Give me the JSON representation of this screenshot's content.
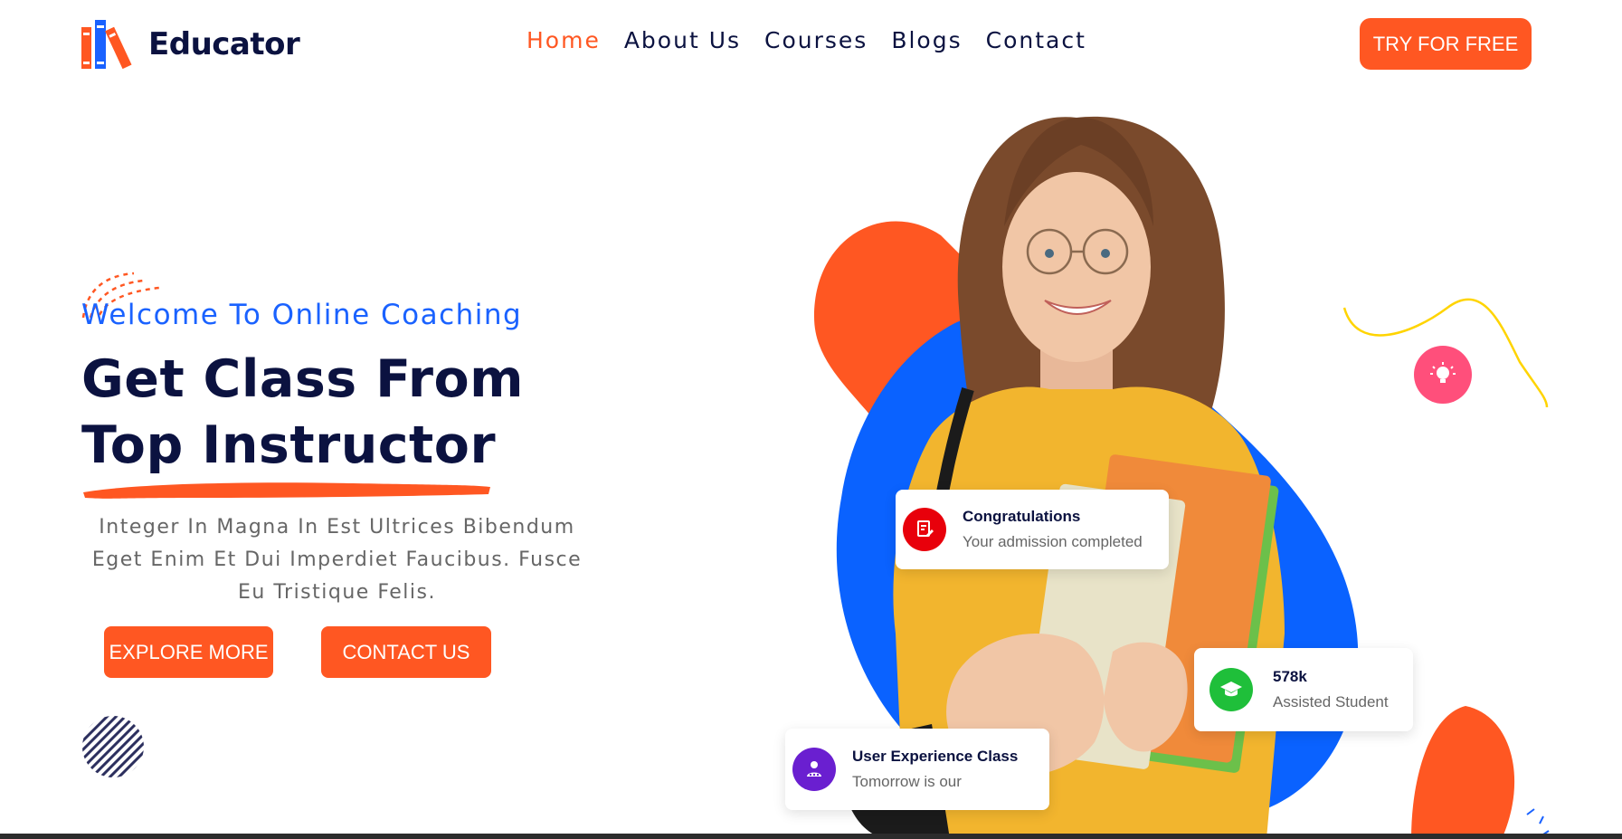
{
  "brand": {
    "name": "Educator",
    "colors": {
      "accent": "#ff5722",
      "primary_blue": "#1a62ff",
      "navy": "#0b1240"
    }
  },
  "nav": {
    "items": [
      {
        "label": "Home",
        "active": true
      },
      {
        "label": "About Us",
        "active": false
      },
      {
        "label": "Courses",
        "active": false
      },
      {
        "label": "Blogs",
        "active": false
      },
      {
        "label": "Contact",
        "active": false
      }
    ],
    "cta": "TRY FOR FREE"
  },
  "hero": {
    "eyebrow": "Welcome To Online Coaching",
    "title_line1": "Get Class From",
    "title_line2": "Top Instructor",
    "description": "Integer In Magna In Est Ultrices Bibendum Eget Enim Et Dui Imperdiet Faucibus. Fusce Eu Tristique Felis.",
    "primary_button": "EXPLORE MORE",
    "secondary_button": "CONTACT US"
  },
  "cards": {
    "congrats": {
      "title": "Congratulations",
      "subtitle": "Your admission completed",
      "icon": "document-edit-icon"
    },
    "students": {
      "title": "578k",
      "subtitle": "Assisted Student",
      "icon": "graduation-cap-icon"
    },
    "ux_class": {
      "title": "User Experience Class",
      "subtitle": "Tomorrow is our",
      "icon": "user-star-icon"
    }
  },
  "decor": {
    "bulb_icon": "lightbulb-icon"
  }
}
